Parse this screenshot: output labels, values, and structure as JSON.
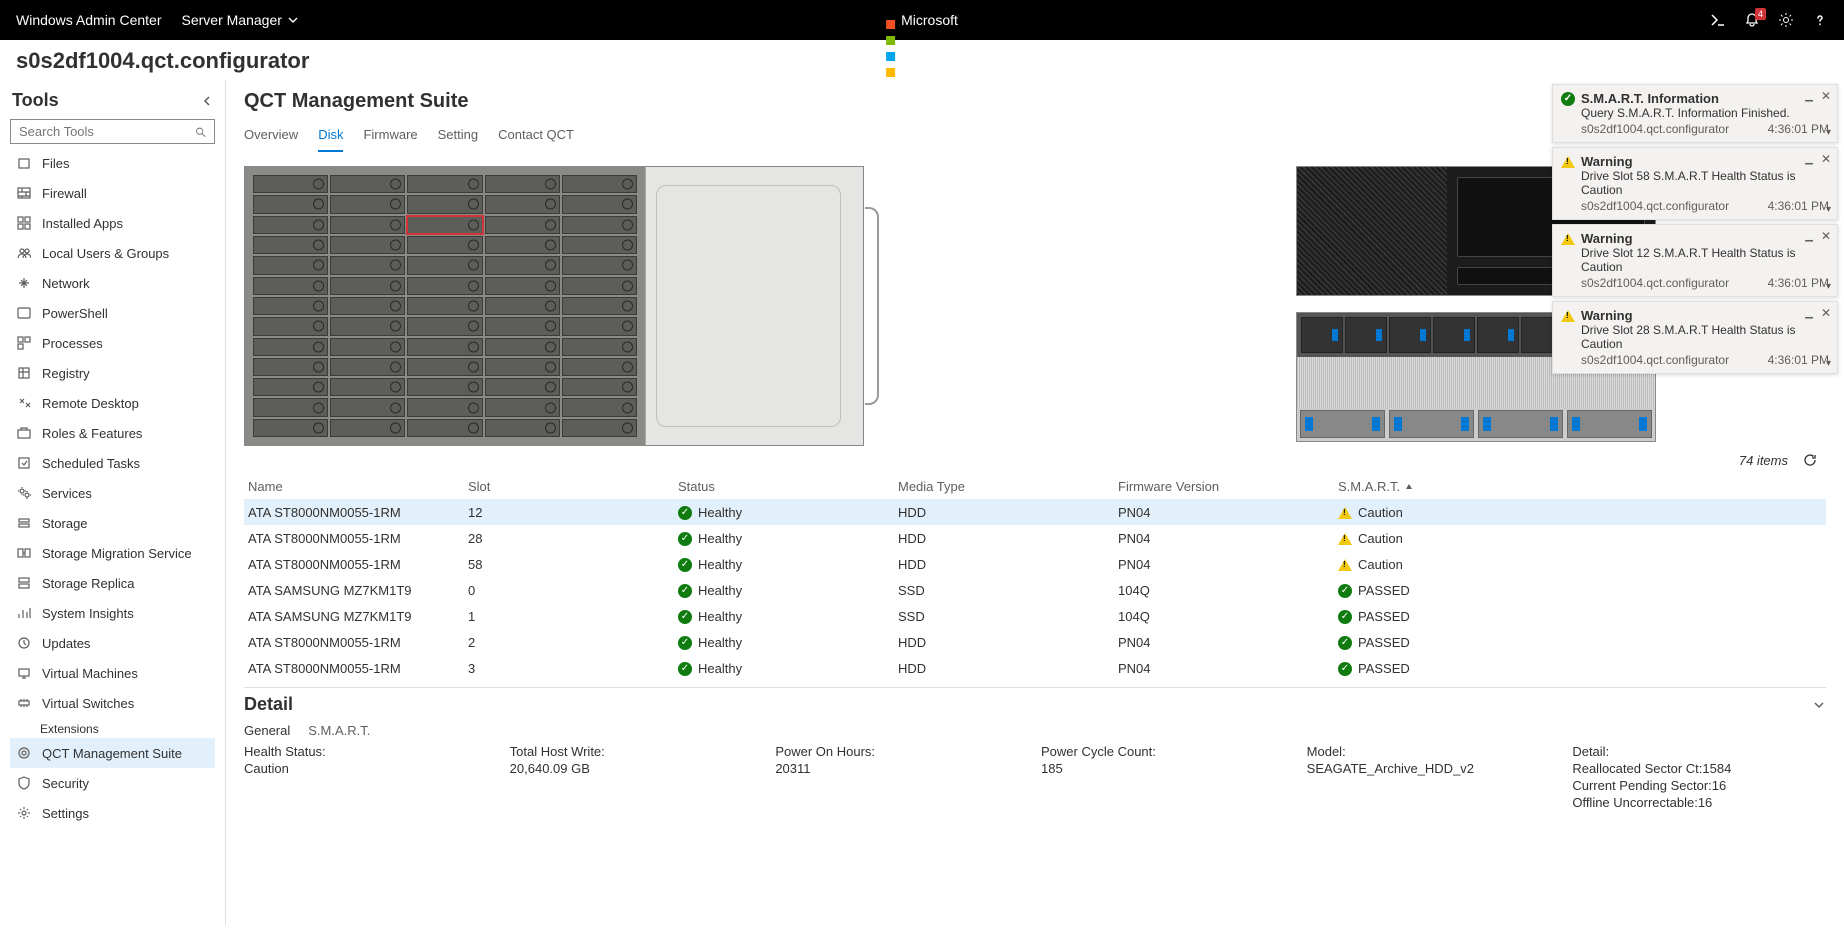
{
  "topbar": {
    "title": "Windows Admin Center",
    "dropdown": "Server Manager",
    "brand": "Microsoft",
    "notif_badge": "4"
  },
  "host": "s0s2df1004.qct.configurator",
  "tools": {
    "header": "Tools",
    "search_placeholder": "Search Tools",
    "items": [
      {
        "label": "Files",
        "icon": "files-icon"
      },
      {
        "label": "Firewall",
        "icon": "firewall-icon"
      },
      {
        "label": "Installed Apps",
        "icon": "apps-icon"
      },
      {
        "label": "Local Users & Groups",
        "icon": "users-icon"
      },
      {
        "label": "Network",
        "icon": "network-icon"
      },
      {
        "label": "PowerShell",
        "icon": "powershell-icon"
      },
      {
        "label": "Processes",
        "icon": "processes-icon"
      },
      {
        "label": "Registry",
        "icon": "registry-icon"
      },
      {
        "label": "Remote Desktop",
        "icon": "remote-desktop-icon"
      },
      {
        "label": "Roles & Features",
        "icon": "roles-icon"
      },
      {
        "label": "Scheduled Tasks",
        "icon": "tasks-icon"
      },
      {
        "label": "Services",
        "icon": "services-icon"
      },
      {
        "label": "Storage",
        "icon": "storage-icon"
      },
      {
        "label": "Storage Migration Service",
        "icon": "storage-migration-icon"
      },
      {
        "label": "Storage Replica",
        "icon": "storage-replica-icon"
      },
      {
        "label": "System Insights",
        "icon": "insights-icon"
      },
      {
        "label": "Updates",
        "icon": "updates-icon"
      },
      {
        "label": "Virtual Machines",
        "icon": "vm-icon"
      },
      {
        "label": "Virtual Switches",
        "icon": "vswitch-icon"
      }
    ],
    "ext_header": "Extensions",
    "ext_items": [
      {
        "label": "QCT Management Suite",
        "icon": "qct-icon",
        "active": true
      },
      {
        "label": "Security",
        "icon": "security-icon"
      },
      {
        "label": "Settings",
        "icon": "settings-icon"
      }
    ]
  },
  "main": {
    "title": "QCT Management Suite",
    "tabs": [
      "Overview",
      "Disk",
      "Firmware",
      "Setting",
      "Contact QCT"
    ],
    "active_tab": 1,
    "items_count": "74 items",
    "columns": [
      "Name",
      "Slot",
      "Status",
      "Media Type",
      "Firmware Version",
      "S.M.A.R.T."
    ],
    "sort_col": 5,
    "rows": [
      {
        "name": "ATA ST8000NM0055-1RM",
        "slot": "12",
        "status": "Healthy",
        "media": "HDD",
        "fw": "PN04",
        "smart": "Caution",
        "smart_icon": "warn",
        "sel": true
      },
      {
        "name": "ATA ST8000NM0055-1RM",
        "slot": "28",
        "status": "Healthy",
        "media": "HDD",
        "fw": "PN04",
        "smart": "Caution",
        "smart_icon": "warn"
      },
      {
        "name": "ATA ST8000NM0055-1RM",
        "slot": "58",
        "status": "Healthy",
        "media": "HDD",
        "fw": "PN04",
        "smart": "Caution",
        "smart_icon": "warn"
      },
      {
        "name": "ATA SAMSUNG MZ7KM1T9",
        "slot": "0",
        "status": "Healthy",
        "media": "SSD",
        "fw": "104Q",
        "smart": "PASSED",
        "smart_icon": "ok"
      },
      {
        "name": "ATA SAMSUNG MZ7KM1T9",
        "slot": "1",
        "status": "Healthy",
        "media": "SSD",
        "fw": "104Q",
        "smart": "PASSED",
        "smart_icon": "ok"
      },
      {
        "name": "ATA ST8000NM0055-1RM",
        "slot": "2",
        "status": "Healthy",
        "media": "HDD",
        "fw": "PN04",
        "smart": "PASSED",
        "smart_icon": "ok"
      },
      {
        "name": "ATA ST8000NM0055-1RM",
        "slot": "3",
        "status": "Healthy",
        "media": "HDD",
        "fw": "PN04",
        "smart": "PASSED",
        "smart_icon": "ok"
      }
    ]
  },
  "detail": {
    "header": "Detail",
    "tabs": [
      "General",
      "S.M.A.R.T."
    ],
    "fields": {
      "health_label": "Health Status:",
      "health_value": "Caution",
      "write_label": "Total Host Write:",
      "write_value": "20,640.09 GB",
      "power_hours_label": "Power On Hours:",
      "power_hours_value": "20311",
      "power_cycle_label": "Power Cycle Count:",
      "power_cycle_value": "185",
      "model_label": "Model:",
      "model_value": "SEAGATE_Archive_HDD_v2",
      "detail_label": "Detail:",
      "detail_lines": [
        "Reallocated Sector Ct:1584",
        "Current Pending Sector:16",
        "Offline Uncorrectable:16"
      ]
    }
  },
  "notifications": [
    {
      "icon": "ok",
      "title": "S.M.A.R.T. Information",
      "body": "Query S.M.A.R.T. Information Finished.",
      "host": "s0s2df1004.qct.configurator",
      "time": "4:36:01 PM"
    },
    {
      "icon": "warn",
      "title": "Warning",
      "body": "Drive Slot 58 S.M.A.R.T Health Status is Caution",
      "host": "s0s2df1004.qct.configurator",
      "time": "4:36:01 PM"
    },
    {
      "icon": "warn",
      "title": "Warning",
      "body": "Drive Slot 12 S.M.A.R.T Health Status is Caution",
      "host": "s0s2df1004.qct.configurator",
      "time": "4:36:01 PM"
    },
    {
      "icon": "warn",
      "title": "Warning",
      "body": "Drive Slot 28 S.M.A.R.T Health Status is Caution",
      "host": "s0s2df1004.qct.configurator",
      "time": "4:36:01 PM"
    }
  ]
}
